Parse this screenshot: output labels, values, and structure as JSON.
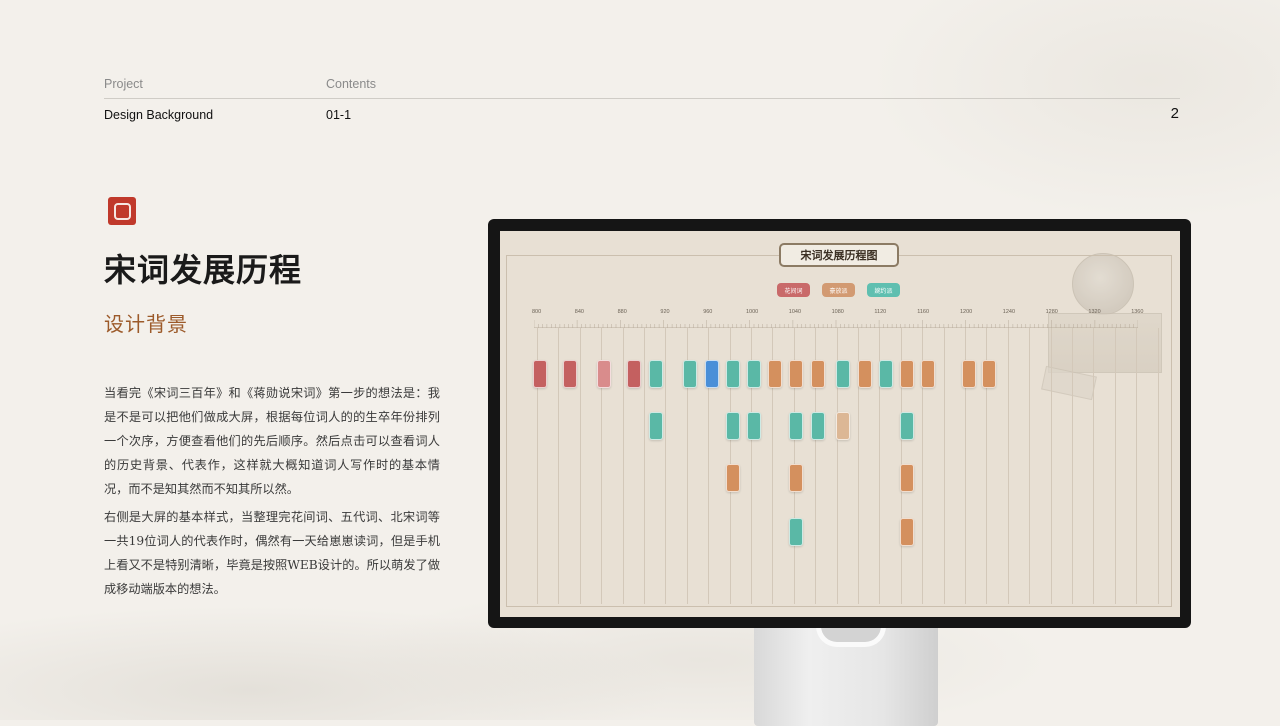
{
  "header": {
    "project_label": "Project",
    "contents_label": "Contents",
    "project_value": "Design Background",
    "contents_value": "01-1",
    "page_number": "2"
  },
  "section": {
    "title": "宋词发展历程",
    "subtitle": "设计背景",
    "paragraphs": [
      "当看完《宋词三百年》和《蒋勋说宋词》第一步的想法是：我是不是可以把他们做成大屏，根据每位词人的的生卒年份排列一个次序，方便查看他们的先后顺序。然后点击可以查看词人的历史背景、代表作，这样就大概知道词人写作时的基本情况，而不是知其然而不知其所以然。",
      "右侧是大屏的基本样式，当整理完花间词、五代词、北宋词等一共19位词人的代表作时，偶然有一天给崽崽读词，但是手机上看又不是特别清晰，毕竟是按照WEB设计的。所以萌发了做成移动端版本的想法。"
    ]
  },
  "screen": {
    "title": "宋词发展历程图",
    "legend": [
      {
        "label": "花间词",
        "color": "#c96a6a"
      },
      {
        "label": "豪放派",
        "color": "#d29a72"
      },
      {
        "label": "婉约派",
        "color": "#5fbfb0"
      }
    ],
    "axis_ticks": [
      "800",
      "840",
      "880",
      "920",
      "960",
      "1000",
      "1040",
      "1080",
      "1120",
      "1160",
      "1200",
      "1240",
      "1280",
      "1320",
      "1360"
    ],
    "poet_colors": {
      "red": "#c46060",
      "pink": "#d98c8c",
      "teal": "#5ab8a6",
      "blue": "#4a8fd8",
      "orange": "#d4905e",
      "tan": "#dcb795"
    }
  }
}
